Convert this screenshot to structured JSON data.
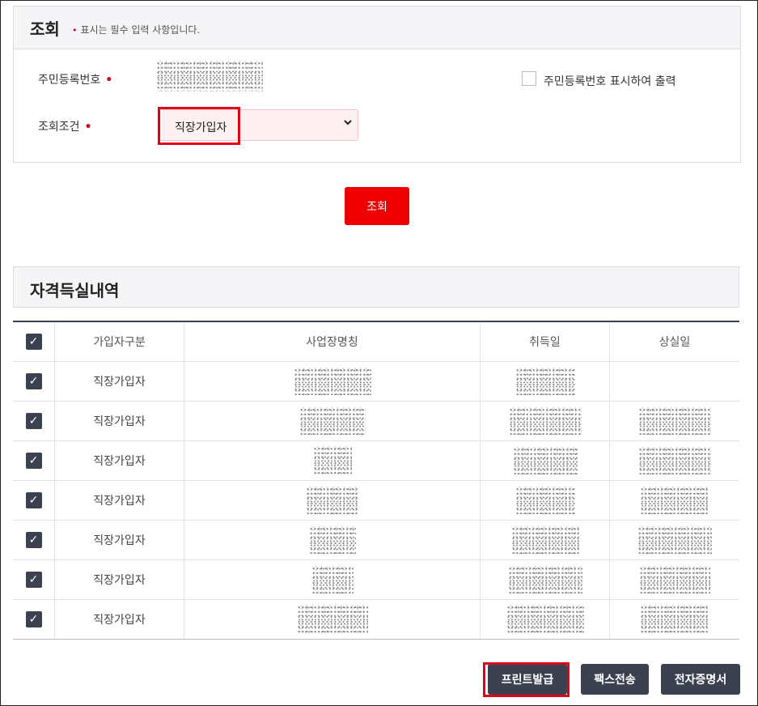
{
  "search": {
    "title": "조회",
    "required_note": "표시는 필수 입력 사항입니다.",
    "required_mark": "•",
    "resident_number_label": "주민등록번호",
    "show_resident_number_label": "주민등록번호 표시하여 출력",
    "condition_label": "조회조건",
    "condition_selected": "직장가입자",
    "chevron_icon": "chevron-down-icon",
    "search_button": "조회",
    "colors": {
      "accent": "#ee0000",
      "required": "#d3001b",
      "select_bg": "#fff0f2"
    }
  },
  "results": {
    "title": "자격득실내역",
    "columns": [
      "가입자구분",
      "사업장명칭",
      "취득일",
      "상실일"
    ],
    "rows": [
      {
        "checked": true,
        "type": "직장가입자"
      },
      {
        "checked": true,
        "type": "직장가입자"
      },
      {
        "checked": true,
        "type": "직장가입자"
      },
      {
        "checked": true,
        "type": "직장가입자"
      },
      {
        "checked": true,
        "type": "직장가입자"
      },
      {
        "checked": true,
        "type": "직장가입자"
      },
      {
        "checked": true,
        "type": "직장가입자"
      }
    ],
    "header_color": "#3c4150"
  },
  "actions": {
    "print_button": "프린트발급",
    "fax_button": "팩스전송",
    "ecert_button": "전자증명서"
  }
}
